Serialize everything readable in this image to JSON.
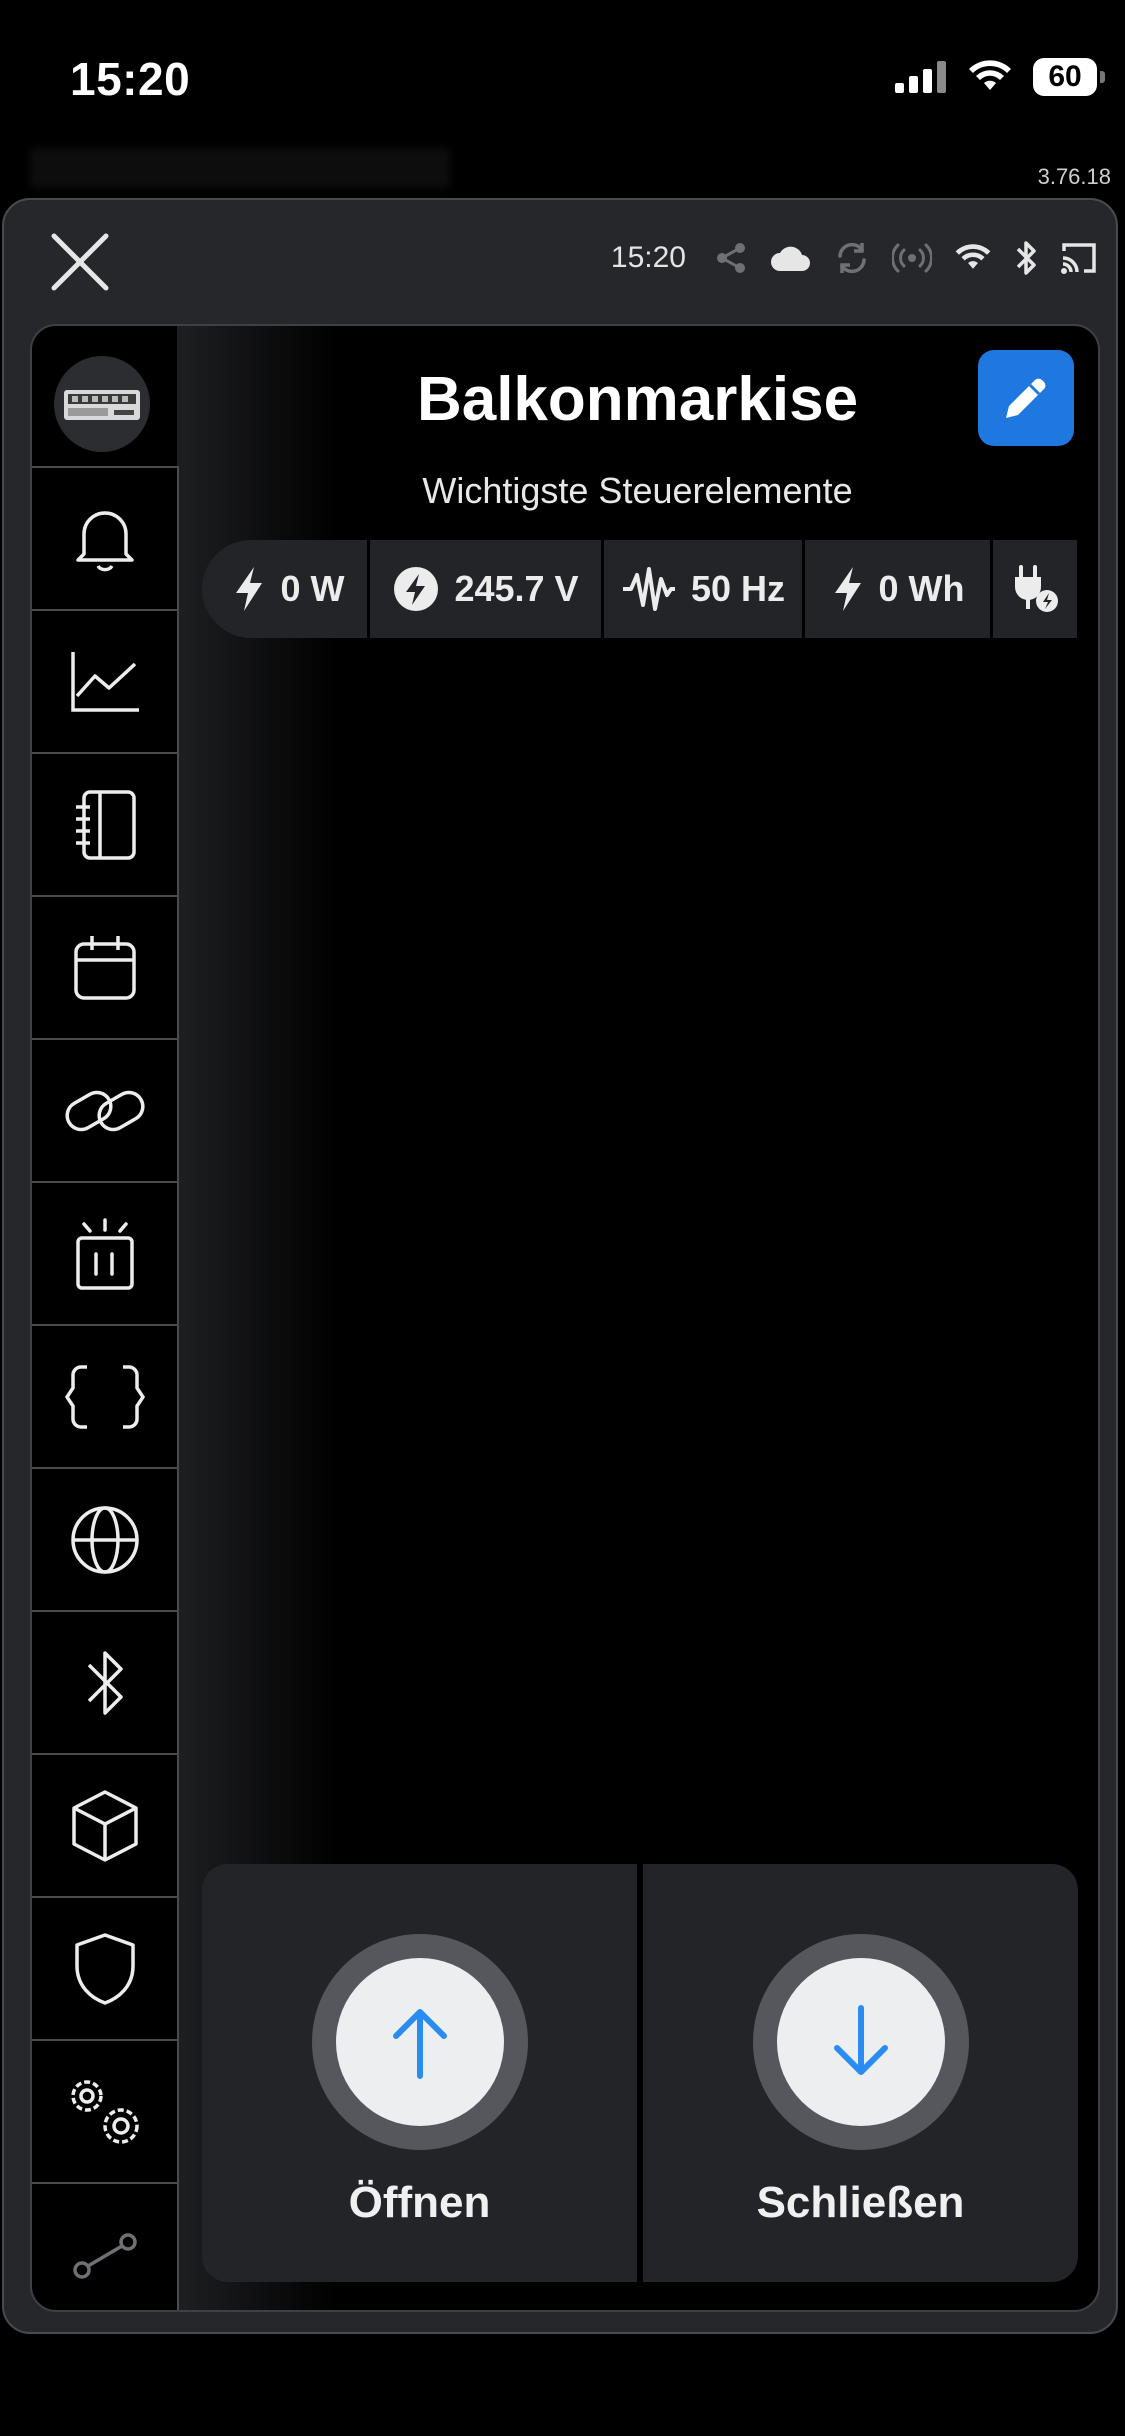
{
  "status_bar": {
    "time": "15:20",
    "battery": "60"
  },
  "app_version": "3.76.18",
  "topbar": {
    "time": "15:20"
  },
  "device": {
    "title": "Balkonmarkise",
    "subtitle": "Wichtigste Steuerelemente"
  },
  "metrics": [
    {
      "icon": "bolt-icon",
      "value": "0 W"
    },
    {
      "icon": "voltage-icon",
      "value": "245.7 V"
    },
    {
      "icon": "frequency-wave-icon",
      "value": "50 Hz"
    },
    {
      "icon": "bolt-icon",
      "value": "0 Wh"
    },
    {
      "icon": "plug-icon",
      "value": ""
    }
  ],
  "sidebar": {
    "items": [
      {
        "icon": "bell-icon"
      },
      {
        "icon": "chart-line-icon"
      },
      {
        "icon": "notebook-icon"
      },
      {
        "icon": "calendar-icon"
      },
      {
        "icon": "link-icon"
      },
      {
        "icon": "alarm-light-icon"
      },
      {
        "icon": "code-braces-icon"
      },
      {
        "icon": "globe-icon"
      },
      {
        "icon": "bluetooth-icon"
      },
      {
        "icon": "cube-icon"
      },
      {
        "icon": "shield-icon"
      },
      {
        "icon": "settings-cogs-icon"
      },
      {
        "icon": "graph-nodes-icon"
      }
    ]
  },
  "controls": {
    "open_label": "Öffnen",
    "close_label": "Schließen"
  },
  "colors": {
    "accent": "#1f78e0",
    "arrow": "#2a8cf0",
    "panel": "#232428"
  }
}
